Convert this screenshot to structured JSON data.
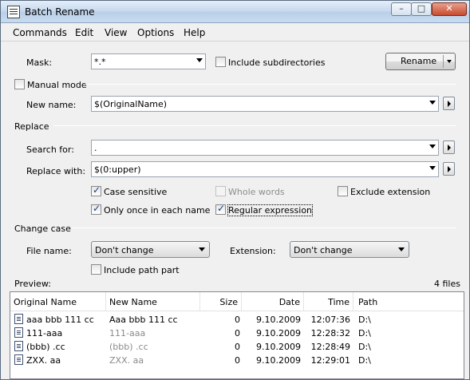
{
  "window": {
    "title": "Batch Rename",
    "caption": {
      "minimize": "–",
      "maximize": "□",
      "close": "✕"
    }
  },
  "menu": [
    "Commands",
    "Edit",
    "View",
    "Options",
    "Help"
  ],
  "mask": {
    "label": "Mask:",
    "value": "*.*",
    "include_subdirs": "Include subdirectories",
    "include_subdirs_checked": false
  },
  "rename_button": "Rename",
  "manual_mode": {
    "label": "Manual mode",
    "checked": false
  },
  "new_name": {
    "label": "New name:",
    "value": "$(OriginalName)"
  },
  "replace": {
    "section": "Replace",
    "search_label": "Search for:",
    "search_value": ".",
    "replace_label": "Replace with:",
    "replace_value": "$(0:upper)",
    "case_sensitive": "Case sensitive",
    "whole_words": "Whole words",
    "exclude_extension": "Exclude extension",
    "only_once": "Only once in each name",
    "regex": "Regular expression"
  },
  "change_case": {
    "section": "Change case",
    "file_name_label": "File name:",
    "file_name_value": "Don't change",
    "extension_label": "Extension:",
    "extension_value": "Don't change",
    "include_path": "Include path part"
  },
  "preview": {
    "label": "Preview:",
    "count": "4 files"
  },
  "table": {
    "headers": [
      "Original Name",
      "New Name",
      "Size",
      "Date",
      "Time",
      "Path"
    ],
    "rows": [
      {
        "orig": "aaa bbb 111    cc",
        "new": "Aaa bbb 111    cc",
        "size": "0",
        "date": "9.10.2009",
        "time": "12:07:36",
        "path": "D:\\"
      },
      {
        "orig": "111-aaa",
        "new": "111-aaa",
        "size": "0",
        "date": "9.10.2009",
        "time": "12:28:32",
        "path": "D:\\"
      },
      {
        "orig": "(bbb)   .cc",
        "new": "(bbb)   .cc",
        "size": "0",
        "date": "9.10.2009",
        "time": "12:28:49",
        "path": "D:\\"
      },
      {
        "orig": "ZXX. aa",
        "new": "ZXX. aa",
        "size": "0",
        "date": "9.10.2009",
        "time": "12:29:01",
        "path": "D:\\"
      }
    ]
  }
}
